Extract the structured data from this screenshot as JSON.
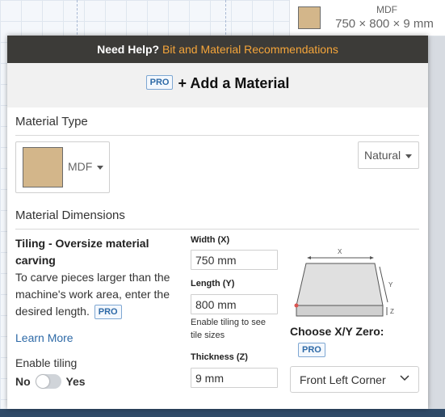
{
  "material_card": {
    "type": "MDF",
    "size": "750 × 800 × 9 mm"
  },
  "help_bar": {
    "prefix": "Need Help?",
    "link": "Bit and Material Recommendations"
  },
  "header": {
    "pro": "PRO",
    "title": "+ Add a Material"
  },
  "material_type": {
    "label": "Material Type",
    "selected": "MDF",
    "finish": "Natural"
  },
  "dimensions": {
    "label": "Material Dimensions",
    "tiling_title": "Tiling - Oversize material carving",
    "tiling_desc": "To carve pieces larger than the machine's work area, enter the desired length.",
    "tiling_pro": "PRO",
    "learn_more": "Learn More",
    "enable_tiling": "Enable tiling",
    "toggle_no": "No",
    "toggle_yes": "Yes",
    "width_label": "Width (X)",
    "width_value": "750 mm",
    "length_label": "Length (Y)",
    "length_value": "800 mm",
    "hint": "Enable tiling to see tile sizes",
    "thickness_label": "Thickness (Z)",
    "thickness_value": "9 mm"
  },
  "zero": {
    "label": "Choose X/Y Zero:",
    "pro": "PRO",
    "selected": "Front Left Corner"
  },
  "diagram_labels": {
    "x": "X",
    "y": "Y",
    "z": "Z"
  },
  "colors": {
    "accent_link": "#f5a53a",
    "pro_blue": "#2e6aa7",
    "swatch_mdf": "#d3b68a",
    "help_bar_bg": "#3c3b38"
  }
}
